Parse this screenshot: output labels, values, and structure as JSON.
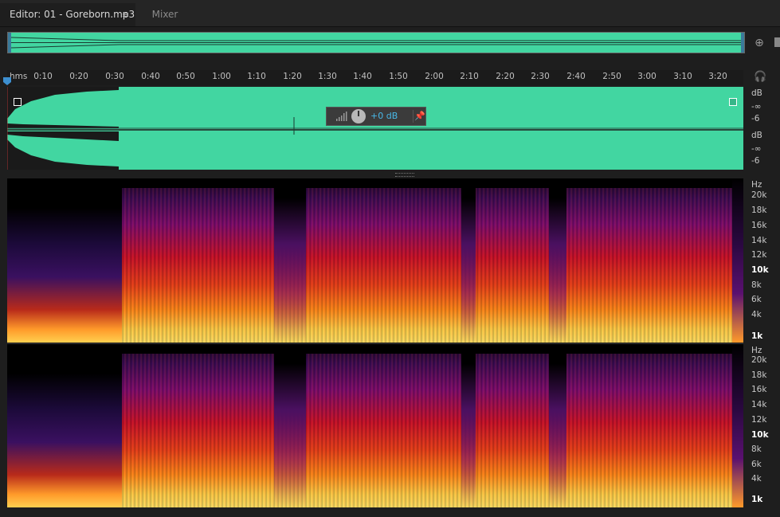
{
  "tabs": {
    "editor_label": "Editor: 01 - Goreborn.mp3",
    "menu_icon": "≡",
    "mixer_label": "Mixer"
  },
  "ruler": {
    "unit": "hms",
    "ticks": [
      "0:10",
      "0:20",
      "0:30",
      "0:40",
      "0:50",
      "1:00",
      "1:10",
      "1:20",
      "1:30",
      "1:40",
      "1:50",
      "2:00",
      "2:10",
      "2:20",
      "2:30",
      "2:40",
      "2:50",
      "3:00",
      "3:10",
      "3:20"
    ]
  },
  "hud": {
    "gain_value": "+0 dB",
    "pin_icon": "pin-icon",
    "knob_icon": "volume-knob-icon"
  },
  "channel_top": {
    "db_label": "dB",
    "neg_inf": "-∞",
    "minus6": "-6"
  },
  "channel_bottom": {
    "db_label": "dB",
    "neg_inf": "-∞",
    "minus6": "-6"
  },
  "spectral_top": {
    "hz_label": "Hz",
    "ticks": [
      "20k",
      "18k",
      "16k",
      "14k",
      "12k",
      "10k",
      "8k",
      "6k",
      "4k",
      "1k"
    ]
  },
  "spectral_bottom": {
    "hz_label": "Hz",
    "ticks": [
      "20k",
      "18k",
      "16k",
      "14k",
      "12k",
      "10k",
      "8k",
      "6k",
      "4k",
      "1k"
    ]
  },
  "icons": {
    "zoom": "zoom-icon",
    "headphones": "headphones-icon"
  },
  "colors": {
    "waveform": "#42d6a1",
    "accent": "#39a0e0",
    "background": "#1e1e1e"
  }
}
